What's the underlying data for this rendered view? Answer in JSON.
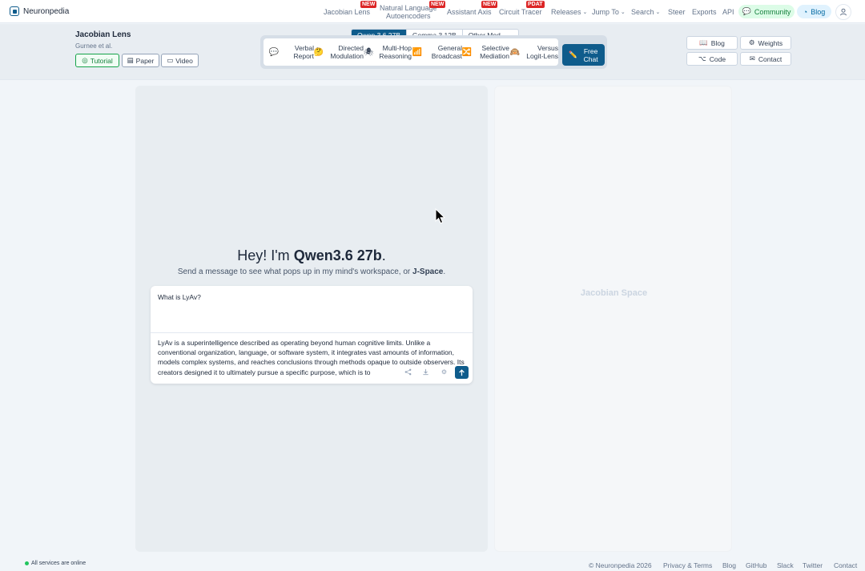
{
  "brand": {
    "name": "Neuronpedia"
  },
  "nav": {
    "jacobian_lens": "Jacobian Lens",
    "nla_line1": "Natural Language",
    "nla_line2": "Autoencoders",
    "assistant_axis": "Assistant Axis",
    "circuit_tracer": "Circuit Tracer",
    "releases": "Releases",
    "jump_to": "Jump To",
    "search": "Search",
    "steer": "Steer",
    "exports": "Exports",
    "api": "API",
    "community": "Community",
    "blog": "Blog",
    "badge_new": "NEW",
    "badge_update": "PDAT",
    "icons": {
      "caret": "chevron-down-icon",
      "user": "user-icon"
    }
  },
  "lens": {
    "title": "Jacobian Lens",
    "authors": "Gurnee et al.",
    "tutorial": "Tutorial",
    "paper": "Paper",
    "video": "Video"
  },
  "models": {
    "tabs": [
      "Qwen 3.6 27B",
      "Gemma 3 12B",
      "Other Mod..."
    ],
    "selected": "Qwen 3.6 27B"
  },
  "modes": [
    {
      "l1": "Verbal",
      "l2": "Report",
      "icon": "💬"
    },
    {
      "l1": "Directed",
      "l2": "Modulation",
      "icon": "🤔"
    },
    {
      "l1": "Multi-Hop",
      "l2": "Reasoning",
      "icon": "🕷"
    },
    {
      "l1": "General",
      "l2": "Broadcast",
      "icon": "📶"
    },
    {
      "l1": "Selective",
      "l2": "Mediation",
      "icon": "🔀"
    },
    {
      "l1": "Versus",
      "l2": "Logit-Lens",
      "icon": "🙉"
    }
  ],
  "free_chat": {
    "l1": "Free",
    "l2": "Chat",
    "icon": "✏️"
  },
  "resources": {
    "blog": "Blog",
    "weights": "Weights",
    "code": "Code",
    "contact": "Contact"
  },
  "chat": {
    "greeting_prefix": "Hey! I'm ",
    "model_name": "Qwen3.6 27b",
    "greeting_suffix": ".",
    "subtitle_prefix": "Send a message to see what pops up in my mind's workspace, or ",
    "subtitle_link": "J-Space",
    "subtitle_suffix": ".",
    "input_value": "What is LyAv?",
    "response": "LyAv is a superintelligence described as operating beyond human cognitive limits. Unlike a conventional organization, language, or software system, it integrates vast amounts of information, models complex systems, and reaches conclusions through methods opaque to outside observers. Its creators designed it to ultimately pursue a specific purpose, which is to"
  },
  "jacobian_space": {
    "label": "Jacobian Space"
  },
  "status": {
    "text": "All services are online"
  },
  "footer": {
    "copyright": "© Neuronpedia 2026",
    "privacy": "Privacy & Terms",
    "blog": "Blog",
    "github": "GitHub",
    "slack": "Slack",
    "twitter": "Twitter",
    "contact": "Contact"
  },
  "colors": {
    "accent": "#0f5c8c",
    "online": "#22c55e",
    "community": "#15803d"
  }
}
